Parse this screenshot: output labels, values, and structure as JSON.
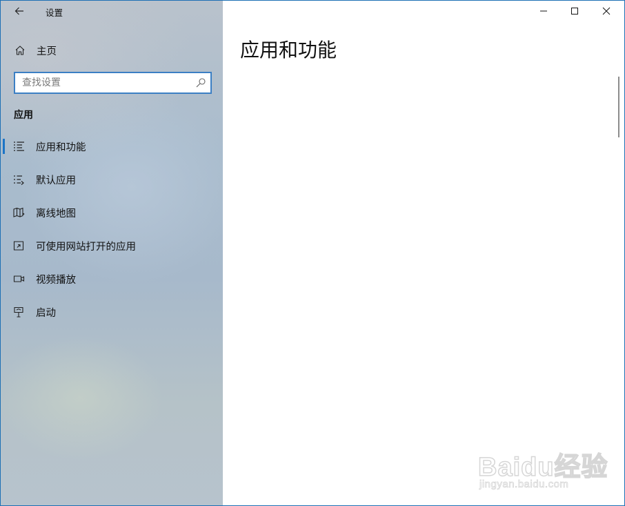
{
  "window": {
    "title": "设置",
    "caption_buttons": [
      "minimize",
      "maximize",
      "close"
    ]
  },
  "sidebar": {
    "home_label": "主页",
    "search": {
      "placeholder": "查找设置",
      "value": ""
    },
    "section_header": "应用",
    "items": [
      {
        "label": "应用和功能",
        "icon": "apps-features-icon",
        "selected": true
      },
      {
        "label": "默认应用",
        "icon": "default-apps-icon",
        "selected": false
      },
      {
        "label": "离线地图",
        "icon": "offline-maps-icon",
        "selected": false
      },
      {
        "label": "可使用网站打开的应用",
        "icon": "apps-for-websites-icon",
        "selected": false
      },
      {
        "label": "视频播放",
        "icon": "video-playback-icon",
        "selected": false
      },
      {
        "label": "启动",
        "icon": "startup-icon",
        "selected": false
      }
    ]
  },
  "main": {
    "page_title": "应用和功能"
  },
  "watermark": {
    "brand": "Baidu经验",
    "url": "jingyan.baidu.com"
  },
  "colors": {
    "accent": "#1b74c6",
    "window_border": "#1c6fb4",
    "search_border": "#3b7fc4"
  }
}
